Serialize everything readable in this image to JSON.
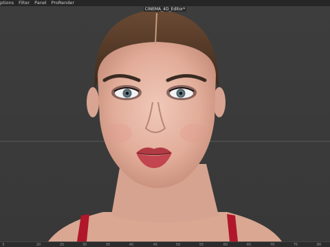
{
  "menu": [
    {
      "id": "options",
      "label": "ptions"
    },
    {
      "id": "filter",
      "label": "Filter"
    },
    {
      "id": "panel",
      "label": "Panel"
    },
    {
      "id": "prorender",
      "label": "ProRender"
    }
  ],
  "viewport": {
    "title": "CINEMA_4D_Editor*"
  },
  "timeline": {
    "ticks": [
      "5",
      "20",
      "25",
      "30",
      "35",
      "40",
      "45",
      "50",
      "55",
      "60",
      "65",
      "70",
      "75",
      "80"
    ]
  }
}
